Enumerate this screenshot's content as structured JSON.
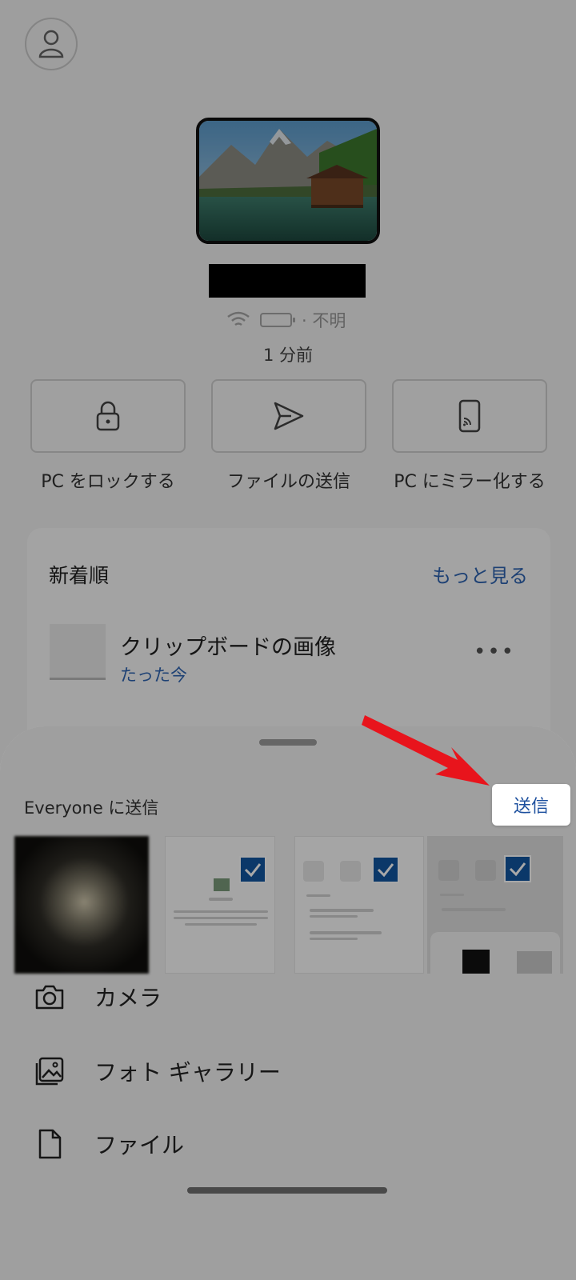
{
  "device": {
    "status_text": "· 不明",
    "last_seen": "1 分前"
  },
  "actions": [
    {
      "label": "PC をロックする",
      "icon": "lock-icon"
    },
    {
      "label": "ファイルの送信",
      "icon": "send-icon"
    },
    {
      "label": "PC にミラー化する",
      "icon": "mirror-phone-icon"
    }
  ],
  "recent": {
    "title": "新着順",
    "more_label": "もっと見る",
    "item": {
      "name": "クリップボードの画像",
      "time": "たった今",
      "menu": "•••"
    }
  },
  "sheet": {
    "title": "Everyone に送信",
    "send_label": "送信",
    "menu": [
      {
        "label": "カメラ",
        "icon": "camera-icon"
      },
      {
        "label": "フォト ギャラリー",
        "icon": "photo-gallery-icon"
      },
      {
        "label": "ファイル",
        "icon": "file-icon"
      }
    ],
    "thumbs": [
      {
        "kind": "photo",
        "selected": false
      },
      {
        "kind": "screenshot",
        "selected": true
      },
      {
        "kind": "screenshot",
        "selected": true
      },
      {
        "kind": "screenshot",
        "selected": true
      }
    ]
  },
  "colors": {
    "accent": "#2f67b6",
    "check": "#1155a0",
    "arrow": "#e8141c"
  }
}
